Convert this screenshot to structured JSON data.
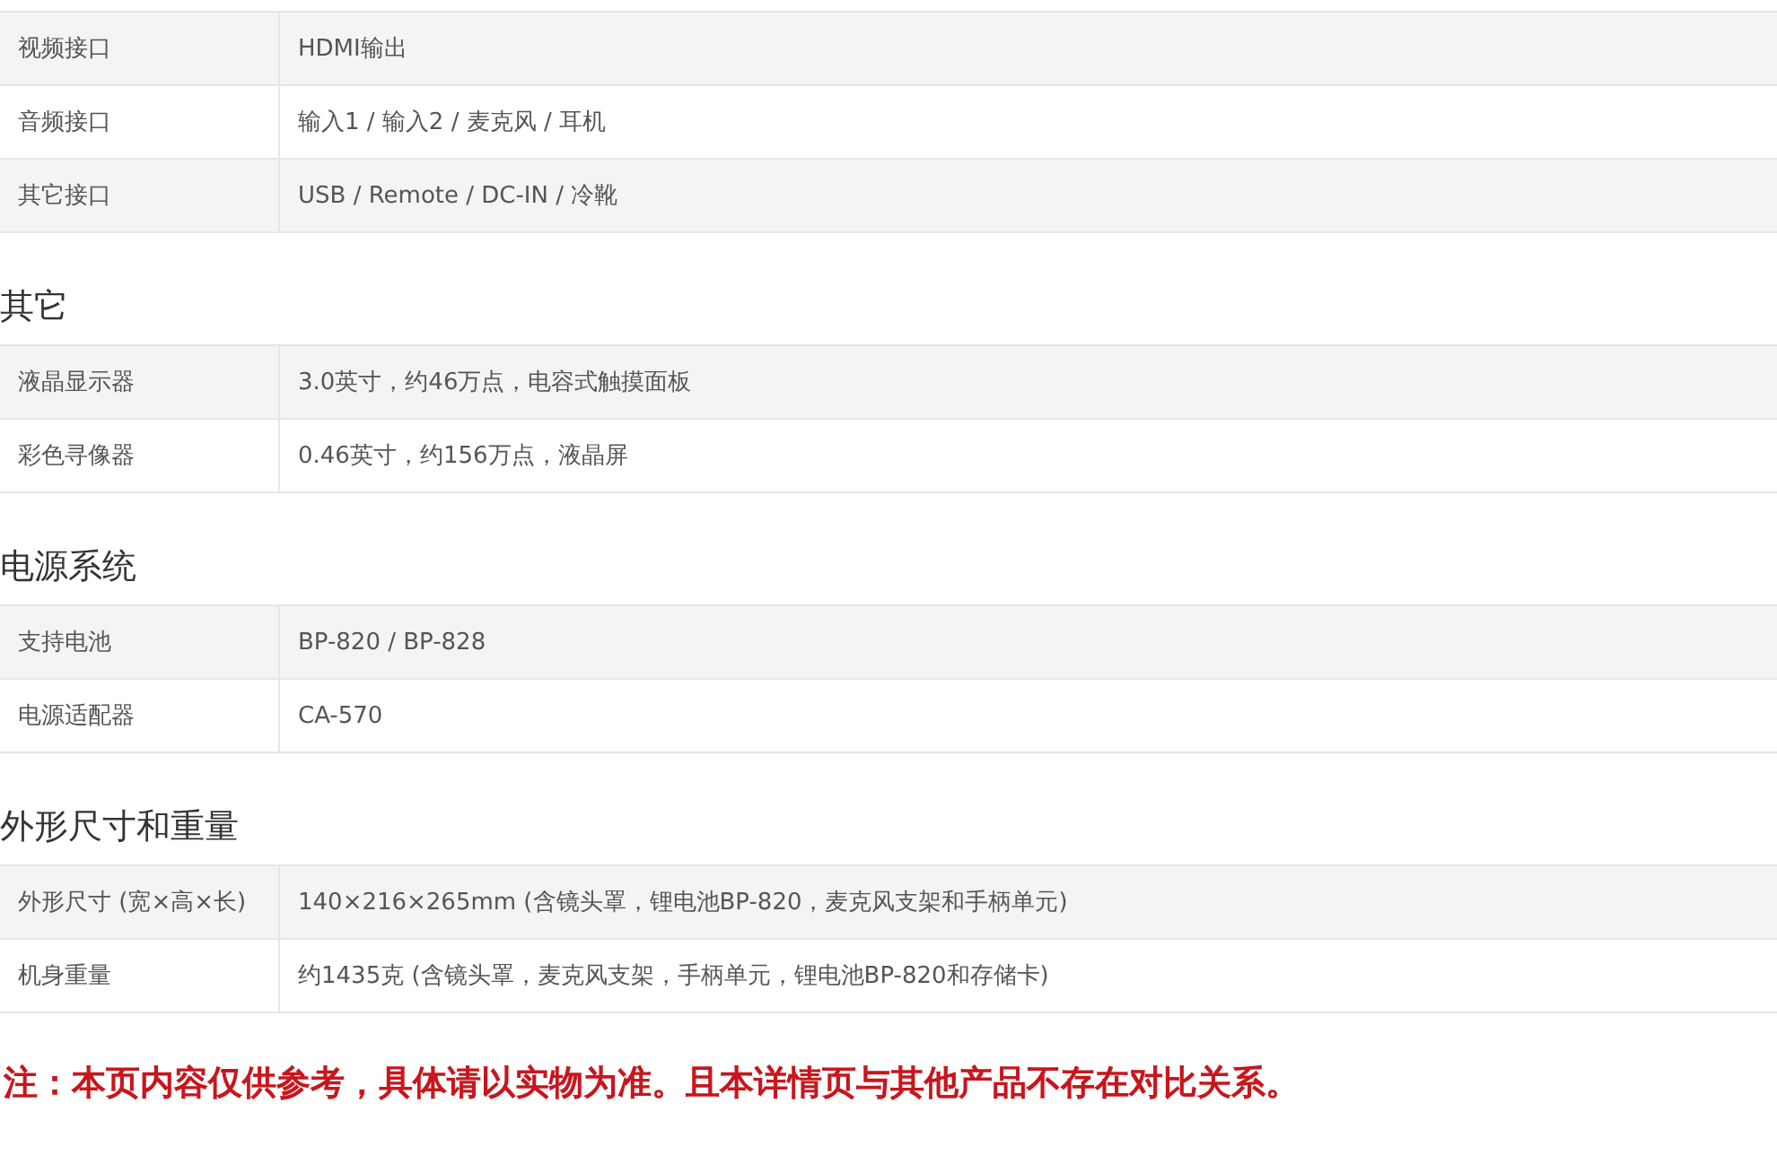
{
  "sections": [
    {
      "rows": [
        {
          "label": "视频接口",
          "value": "HDMI输出"
        },
        {
          "label": "音频接口",
          "value": "输入1 / 输入2 / 麦克风 / 耳机"
        },
        {
          "label": "其它接口",
          "value": "USB / Remote / DC-IN / 冷靴"
        }
      ]
    },
    {
      "title": "其它",
      "rows": [
        {
          "label": "液晶显示器",
          "value": "3.0英寸，约46万点，电容式触摸面板"
        },
        {
          "label": "彩色寻像器",
          "value": "0.46英寸，约156万点，液晶屏"
        }
      ]
    },
    {
      "title": "电源系统",
      "rows": [
        {
          "label": "支持电池",
          "value": "BP-820 / BP-828"
        },
        {
          "label": "电源适配器",
          "value": "CA-570"
        }
      ]
    },
    {
      "title": "外形尺寸和重量",
      "rows": [
        {
          "label": "外形尺寸 (宽×高×长)",
          "value": "140×216×265mm (含镜头罩，锂电池BP-820，麦克风支架和手柄单元)"
        },
        {
          "label": "机身重量",
          "value": "约1435克 (含镜头罩，麦克风支架，手柄单元，锂电池BP-820和存储卡)"
        }
      ]
    }
  ],
  "note": "注：本页内容仅供参考，具体请以实物为准。且本详情页与其他产品不存在对比关系。"
}
